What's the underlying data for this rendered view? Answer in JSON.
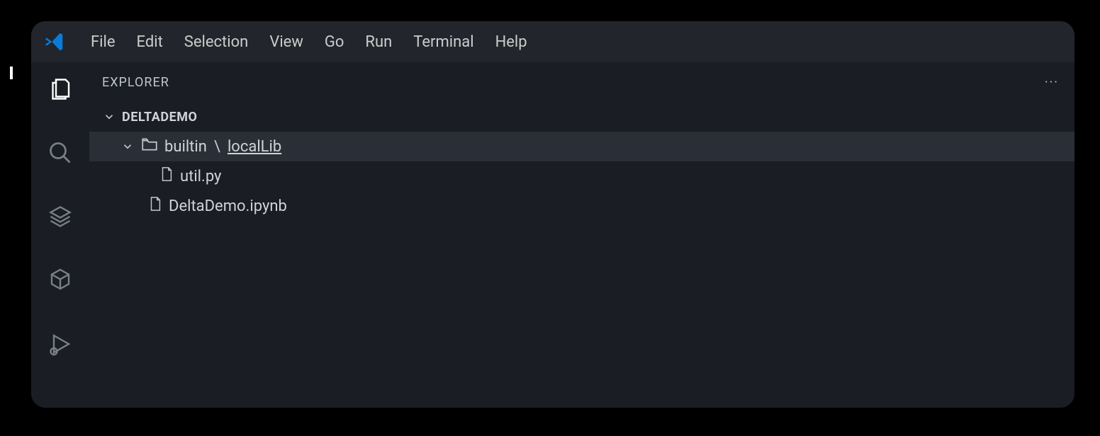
{
  "menu": {
    "file": "File",
    "edit": "Edit",
    "selection": "Selection",
    "view": "View",
    "go": "Go",
    "run": "Run",
    "terminal": "Terminal",
    "help": "Help"
  },
  "sidebar": {
    "title": "EXPLORER",
    "root": "DELTADEMO",
    "folder_prefix": "builtin",
    "folder_name": "localLib",
    "files": {
      "util": "util.py",
      "deltademo": "DeltaDemo.ipynb"
    }
  }
}
